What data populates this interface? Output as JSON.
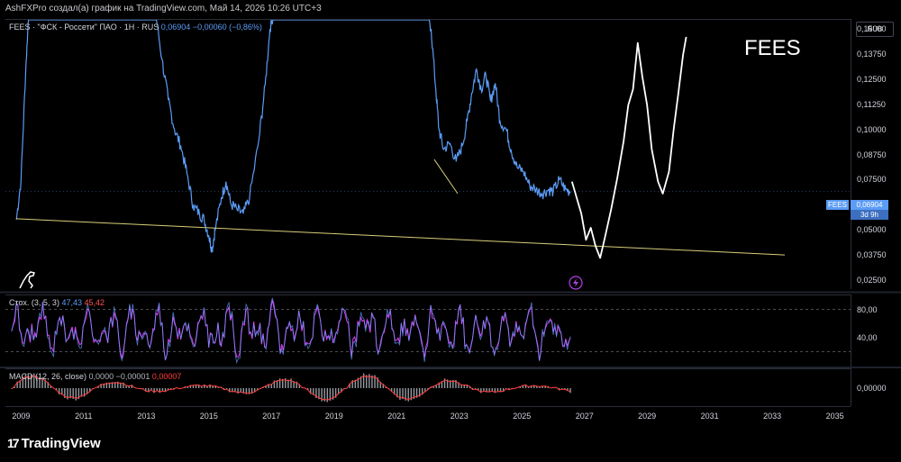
{
  "header": {
    "attribution": "AshFXPro создал(а) график на TradingView.com, Май 14, 2026 10:26 UTC+3"
  },
  "currency_badge": "RUB",
  "overlay_label": "FEES",
  "price_legend": {
    "prefix": "FEES · \"ФСК - Россети\" ПАО · 1H · RUS",
    "last": "0,06904",
    "change": "−0,00060 (−0,86%)"
  },
  "price_tag": {
    "symbol": "FEES",
    "value": "0,06904",
    "countdown": "3d 9h"
  },
  "stoch_legend": {
    "prefix": "Стох. (3, 5, 3)",
    "k": "47,43",
    "d": "45,42"
  },
  "macd_legend": {
    "prefix": "MACD (12, 26, close)",
    "v1": "0,0000",
    "v2": "−0,00001",
    "v3": "0,00007"
  },
  "brand": {
    "mark": "17",
    "name": "TradingView"
  },
  "colors": {
    "price": "#5b9cf6",
    "trendline": "#d8cf7a",
    "stoch_k": "#5b9cf6",
    "stoch_d": "#e040fb",
    "macd_line": "#ff3b3b",
    "histogram": "#b2b5be",
    "projection": "#ffffff"
  },
  "chart_data": {
    "type": "line",
    "xlabel": "",
    "ylabel": "",
    "x_ticks": [
      "2009",
      "2011",
      "2013",
      "2015",
      "2017",
      "2019",
      "2021",
      "2023",
      "2025",
      "2027",
      "2029",
      "2031",
      "2033",
      "2035"
    ],
    "y_ticks": [
      "0,15000",
      "0,13750",
      "0,12500",
      "0,11250",
      "0,10000",
      "0,08750",
      "0,07500",
      "0,05000",
      "0,03750",
      "0,02500"
    ],
    "ylim": [
      0.0205,
      0.1545
    ],
    "xlim": [
      2008.5,
      2035.5
    ],
    "series": [
      {
        "points": [
          [
            2008.85,
            0.055
          ],
          [
            2009.0,
            0.075
          ],
          [
            2009.15,
            0.13
          ],
          [
            2009.25,
            0.16
          ],
          [
            2009.4,
            0.16
          ],
          [
            2009.6,
            0.165
          ],
          [
            2010.5,
            0.17
          ],
          [
            2011.5,
            0.17
          ],
          [
            2012.5,
            0.165
          ],
          [
            2013.3,
            0.158
          ],
          [
            2013.5,
            0.135
          ],
          [
            2013.7,
            0.115
          ],
          [
            2013.9,
            0.1
          ],
          [
            2014.1,
            0.092
          ],
          [
            2014.3,
            0.078
          ],
          [
            2014.5,
            0.062
          ],
          [
            2014.7,
            0.058
          ],
          [
            2014.85,
            0.055
          ],
          [
            2015.0,
            0.047
          ],
          [
            2015.1,
            0.04
          ],
          [
            2015.2,
            0.05
          ],
          [
            2015.4,
            0.066
          ],
          [
            2015.55,
            0.074
          ],
          [
            2015.7,
            0.063
          ],
          [
            2015.9,
            0.06
          ],
          [
            2016.1,
            0.058
          ],
          [
            2016.3,
            0.066
          ],
          [
            2016.6,
            0.095
          ],
          [
            2016.8,
            0.122
          ],
          [
            2016.95,
            0.15
          ],
          [
            2017.1,
            0.16
          ],
          [
            2017.5,
            0.165
          ],
          [
            2018.5,
            0.165
          ],
          [
            2019.5,
            0.165
          ],
          [
            2020.5,
            0.165
          ],
          [
            2021.5,
            0.164
          ],
          [
            2021.95,
            0.16
          ],
          [
            2022.1,
            0.15
          ],
          [
            2022.25,
            0.12
          ],
          [
            2022.35,
            0.1
          ],
          [
            2022.5,
            0.09
          ],
          [
            2022.7,
            0.093
          ],
          [
            2022.9,
            0.084
          ],
          [
            2023.1,
            0.092
          ],
          [
            2023.25,
            0.104
          ],
          [
            2023.4,
            0.118
          ],
          [
            2023.55,
            0.13
          ],
          [
            2023.7,
            0.12
          ],
          [
            2023.85,
            0.127
          ],
          [
            2024.0,
            0.114
          ],
          [
            2024.15,
            0.123
          ],
          [
            2024.3,
            0.104
          ],
          [
            2024.5,
            0.1
          ],
          [
            2024.65,
            0.09
          ],
          [
            2024.85,
            0.081
          ],
          [
            2025.05,
            0.079
          ],
          [
            2025.25,
            0.072
          ],
          [
            2025.45,
            0.07
          ],
          [
            2025.65,
            0.068
          ],
          [
            2025.85,
            0.07
          ],
          [
            2026.0,
            0.069
          ],
          [
            2026.2,
            0.075
          ],
          [
            2026.4,
            0.07
          ],
          [
            2026.55,
            0.06904
          ]
        ]
      }
    ],
    "trendlines": [
      {
        "from": [
          2008.85,
          0.0555
        ],
        "to": [
          2033.4,
          0.0375
        ]
      },
      {
        "from": [
          2022.2,
          0.085
        ],
        "to": [
          2022.95,
          0.068
        ]
      }
    ],
    "projection": [
      [
        2026.6,
        0.074
      ],
      [
        2026.75,
        0.066
      ],
      [
        2026.9,
        0.058
      ],
      [
        2027.05,
        0.045
      ],
      [
        2027.2,
        0.051
      ],
      [
        2027.35,
        0.042
      ],
      [
        2027.5,
        0.036
      ],
      [
        2027.65,
        0.046
      ],
      [
        2027.85,
        0.06
      ],
      [
        2028.05,
        0.076
      ],
      [
        2028.25,
        0.094
      ],
      [
        2028.4,
        0.112
      ],
      [
        2028.55,
        0.12
      ],
      [
        2028.7,
        0.143
      ],
      [
        2028.85,
        0.126
      ],
      [
        2029.0,
        0.112
      ],
      [
        2029.15,
        0.09
      ],
      [
        2029.35,
        0.074
      ],
      [
        2029.5,
        0.068
      ],
      [
        2029.7,
        0.079
      ],
      [
        2029.85,
        0.1
      ],
      [
        2030.0,
        0.118
      ],
      [
        2030.15,
        0.137
      ],
      [
        2030.25,
        0.146
      ]
    ],
    "stoch": {
      "ylim": [
        0,
        100
      ],
      "y_ticks": [
        "80,00",
        "40,00"
      ],
      "levels": [
        80,
        20
      ],
      "x_range": [
        2008.7,
        2026.55
      ]
    },
    "macd": {
      "y_ticks": [
        "0,00000"
      ]
    }
  }
}
